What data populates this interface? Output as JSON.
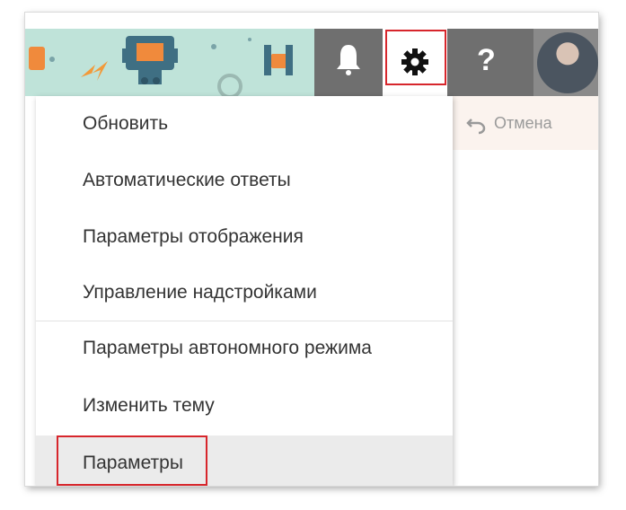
{
  "header": {
    "bell_icon": "bell-icon",
    "gear_icon": "gear-icon",
    "help_icon": "help-icon",
    "help_label": "?"
  },
  "toolbar": {
    "cancel_label": "Отмена",
    "undo_icon": "undo-icon"
  },
  "menu": {
    "items": [
      {
        "label": "Обновить"
      },
      {
        "label": "Автоматические ответы"
      },
      {
        "label": "Параметры отображения"
      },
      {
        "label": "Управление надстройками"
      },
      {
        "label": "Параметры автономного режима"
      },
      {
        "label": "Изменить тему"
      },
      {
        "label": "Параметры"
      }
    ]
  },
  "colors": {
    "banner": "#bfe3d9",
    "tile_gray": "#6f6f6f",
    "highlight_red": "#d7262c",
    "selected_bg": "#ebebeb"
  }
}
